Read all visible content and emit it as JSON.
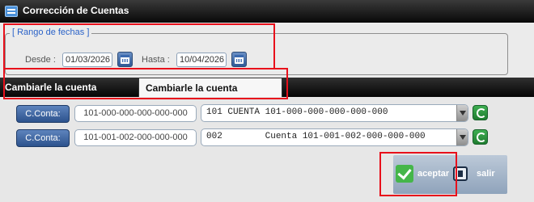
{
  "window": {
    "title": "Corrección de Cuentas",
    "icon": "table-icon"
  },
  "date_range": {
    "legend": "[ Rango de fechas ]",
    "from_label": "Desde :",
    "from_value": "01/03/2026",
    "to_label": "Hasta :",
    "to_value": "10/04/2026"
  },
  "tabs": [
    {
      "label": "Cambiarle la cuenta contable",
      "active": false
    },
    {
      "label": "Cambiarle la cuenta corriente",
      "active": true
    }
  ],
  "rows": [
    {
      "button_label": "C.Conta:",
      "account_value": "101-000-000-000-000-000",
      "combo_value": "101 CUENTA 101-000-000-000-000-000"
    },
    {
      "button_label": "C.Conta:",
      "account_value": "101-001-002-000-000-000",
      "combo_value": "002        Cuenta 101-001-002-000-000-000"
    }
  ],
  "actions": {
    "accept_label": "aceptar",
    "exit_label": "salir"
  },
  "colors": {
    "highlight": "#e8101b",
    "legend": "#2a62c8",
    "accent_blue": "#2f5a96",
    "accent_green": "#1f7d30"
  }
}
